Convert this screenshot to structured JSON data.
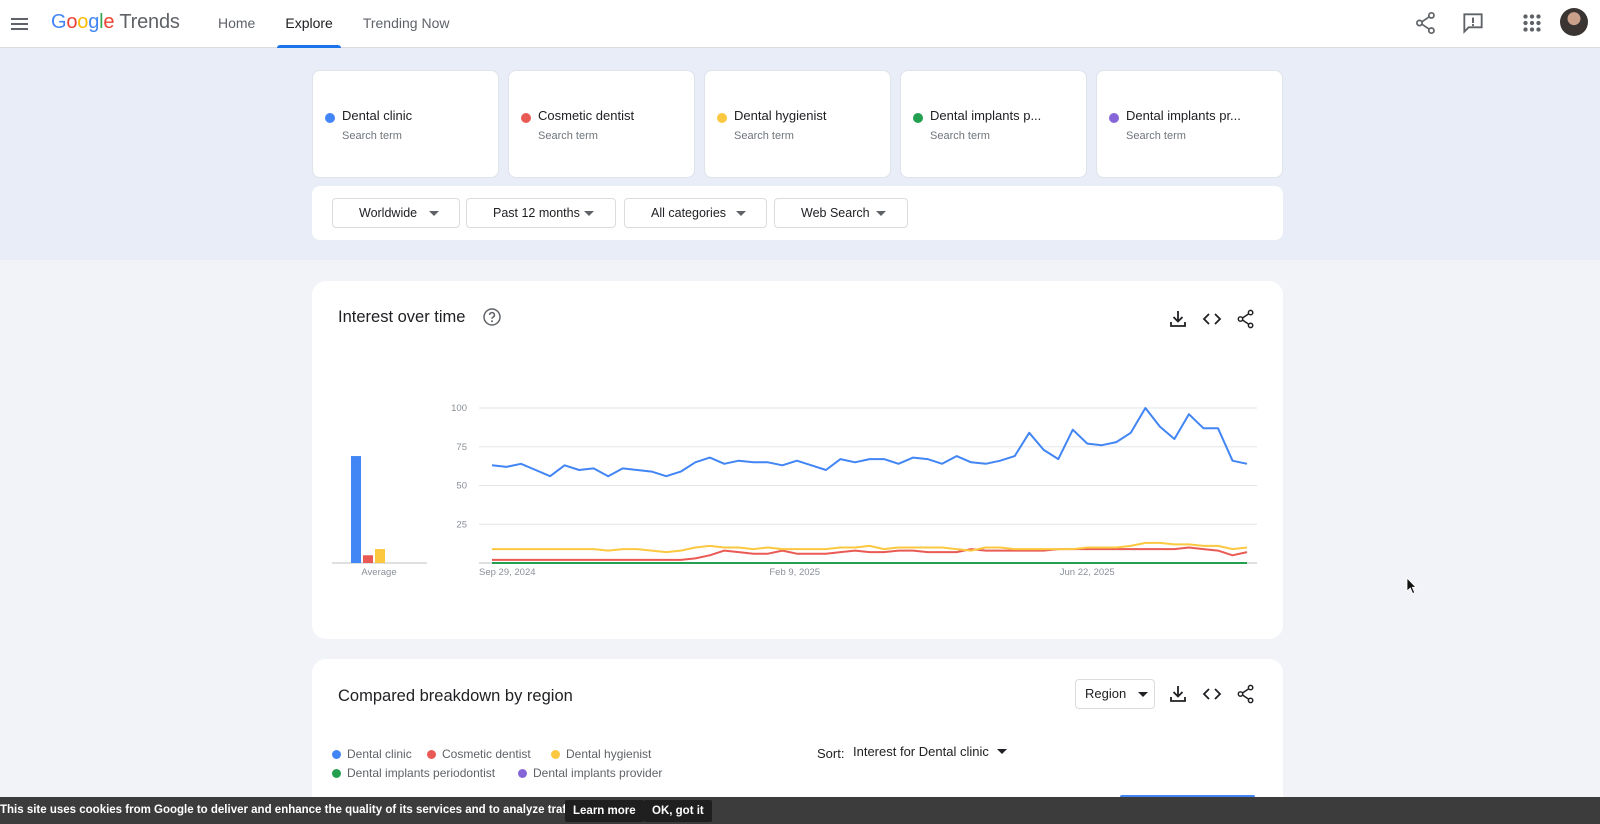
{
  "app": {
    "logo_google": [
      "G",
      "o",
      "o",
      "g",
      "l",
      "e"
    ],
    "logo_trends": "Trends"
  },
  "nav": {
    "tabs": [
      {
        "label": "Home",
        "active": false
      },
      {
        "label": "Explore",
        "active": true
      },
      {
        "label": "Trending Now",
        "active": false
      }
    ]
  },
  "header_icons": [
    "share-icon",
    "feedback-icon",
    "apps-grid-icon",
    "avatar"
  ],
  "terms": [
    {
      "name": "Dental clinic",
      "sub": "Search term",
      "color": "#4285f4"
    },
    {
      "name": "Cosmetic dentist",
      "sub": "Search term",
      "color": "#ea5a54"
    },
    {
      "name": "Dental hygienist",
      "sub": "Search term",
      "color": "#fbc840"
    },
    {
      "name": "Dental implants p...",
      "sub": "Search term",
      "color": "#23a04f"
    },
    {
      "name": "Dental implants pr...",
      "sub": "Search term",
      "color": "#8566d8"
    }
  ],
  "filters": {
    "location": "Worldwide",
    "time": "Past 12 months",
    "category": "All categories",
    "property": "Web Search"
  },
  "interest_over_time": {
    "title": "Interest over time",
    "average_label": "Average"
  },
  "chart_data": {
    "type": "line",
    "title": "Interest over time",
    "y_ticks": [
      "100",
      "75",
      "50",
      "25"
    ],
    "ylim": [
      0,
      100
    ],
    "x_tick_labels": [
      "Sep 29, 2024",
      "Feb 9, 2025",
      "Jun 22, 2025"
    ],
    "grid": true,
    "legend": "none",
    "series": [
      {
        "name": "Dental clinic",
        "color": "#4285f4",
        "values": [
          63,
          62,
          64,
          60,
          56,
          63,
          60,
          61,
          56,
          61,
          60,
          59,
          56,
          59,
          65,
          68,
          64,
          66,
          65,
          65,
          63,
          66,
          63,
          60,
          67,
          65,
          67,
          67,
          64,
          68,
          67,
          64,
          69,
          65,
          64,
          66,
          69,
          84,
          73,
          67,
          86,
          77,
          76,
          78,
          84,
          100,
          88,
          80,
          96,
          87,
          87,
          66,
          64
        ]
      },
      {
        "name": "Cosmetic dentist",
        "color": "#ea5a54",
        "values": [
          2,
          2,
          2,
          2,
          2,
          2,
          2,
          2,
          2,
          2,
          2,
          2,
          2,
          2,
          3,
          5,
          8,
          7,
          6,
          6,
          8,
          6,
          6,
          6,
          7,
          8,
          7,
          7,
          8,
          8,
          7,
          7,
          7,
          9,
          8,
          8,
          8,
          8,
          8,
          9,
          9,
          9,
          9,
          9,
          9,
          9,
          9,
          9,
          10,
          9,
          8,
          5,
          7
        ]
      },
      {
        "name": "Dental hygienist",
        "color": "#fbc840",
        "values": [
          9,
          9,
          9,
          9,
          9,
          9,
          9,
          9,
          8,
          9,
          9,
          8,
          7,
          8,
          10,
          11,
          10,
          10,
          9,
          10,
          9,
          9,
          9,
          9,
          10,
          10,
          11,
          9,
          10,
          10,
          10,
          10,
          9,
          8,
          10,
          10,
          9,
          9,
          9,
          9,
          9,
          10,
          10,
          10,
          11,
          13,
          13,
          12,
          12,
          11,
          11,
          9,
          10
        ]
      },
      {
        "name": "Dental implants periodontist",
        "color": "#23a04f",
        "values": [
          0,
          0,
          0,
          0,
          0,
          0,
          0,
          0,
          0,
          0,
          0,
          0,
          0,
          0,
          0,
          0,
          0,
          0,
          0,
          0,
          0,
          0,
          0,
          0,
          0,
          0,
          0,
          0,
          0,
          0,
          0,
          0,
          0,
          0,
          0,
          0,
          0,
          0,
          0,
          0,
          0,
          0,
          0,
          0,
          0,
          0,
          0,
          0,
          0,
          0,
          0,
          0,
          0
        ]
      },
      {
        "name": "Dental implants provider",
        "color": "#8566d8",
        "values": [
          0,
          0,
          0,
          0,
          0,
          0,
          0,
          0,
          0,
          0,
          0,
          0,
          0,
          0,
          0,
          0,
          0,
          0,
          0,
          0,
          0,
          0,
          0,
          0,
          0,
          0,
          0,
          0,
          0,
          0,
          0,
          0,
          0,
          0,
          0,
          0,
          0,
          0,
          0,
          0,
          0,
          0,
          0,
          0,
          0,
          0,
          0,
          0,
          0,
          0,
          0,
          0,
          0
        ]
      }
    ],
    "averages": [
      {
        "name": "Dental clinic",
        "value": 69,
        "color": "#4285f4"
      },
      {
        "name": "Cosmetic dentist",
        "value": 5,
        "color": "#ea5a54"
      },
      {
        "name": "Dental hygienist",
        "value": 9,
        "color": "#fbc840"
      }
    ]
  },
  "region_breakdown": {
    "title": "Compared breakdown by region",
    "resolution": "Region",
    "legend": [
      {
        "name": "Dental clinic",
        "color": "#4285f4"
      },
      {
        "name": "Cosmetic dentist",
        "color": "#ea5a54"
      },
      {
        "name": "Dental hygienist",
        "color": "#fbc840"
      },
      {
        "name": "Dental implants periodontist",
        "color": "#23a04f"
      },
      {
        "name": "Dental implants provider",
        "color": "#8566d8"
      }
    ],
    "sort_label": "Sort:",
    "sort_value": "Interest for Dental clinic"
  },
  "cookie_banner": {
    "text": "This site uses cookies from Google to deliver and enhance the quality of its services and to analyze traffic.",
    "learn_more": "Learn more",
    "ok": "OK, got it"
  }
}
